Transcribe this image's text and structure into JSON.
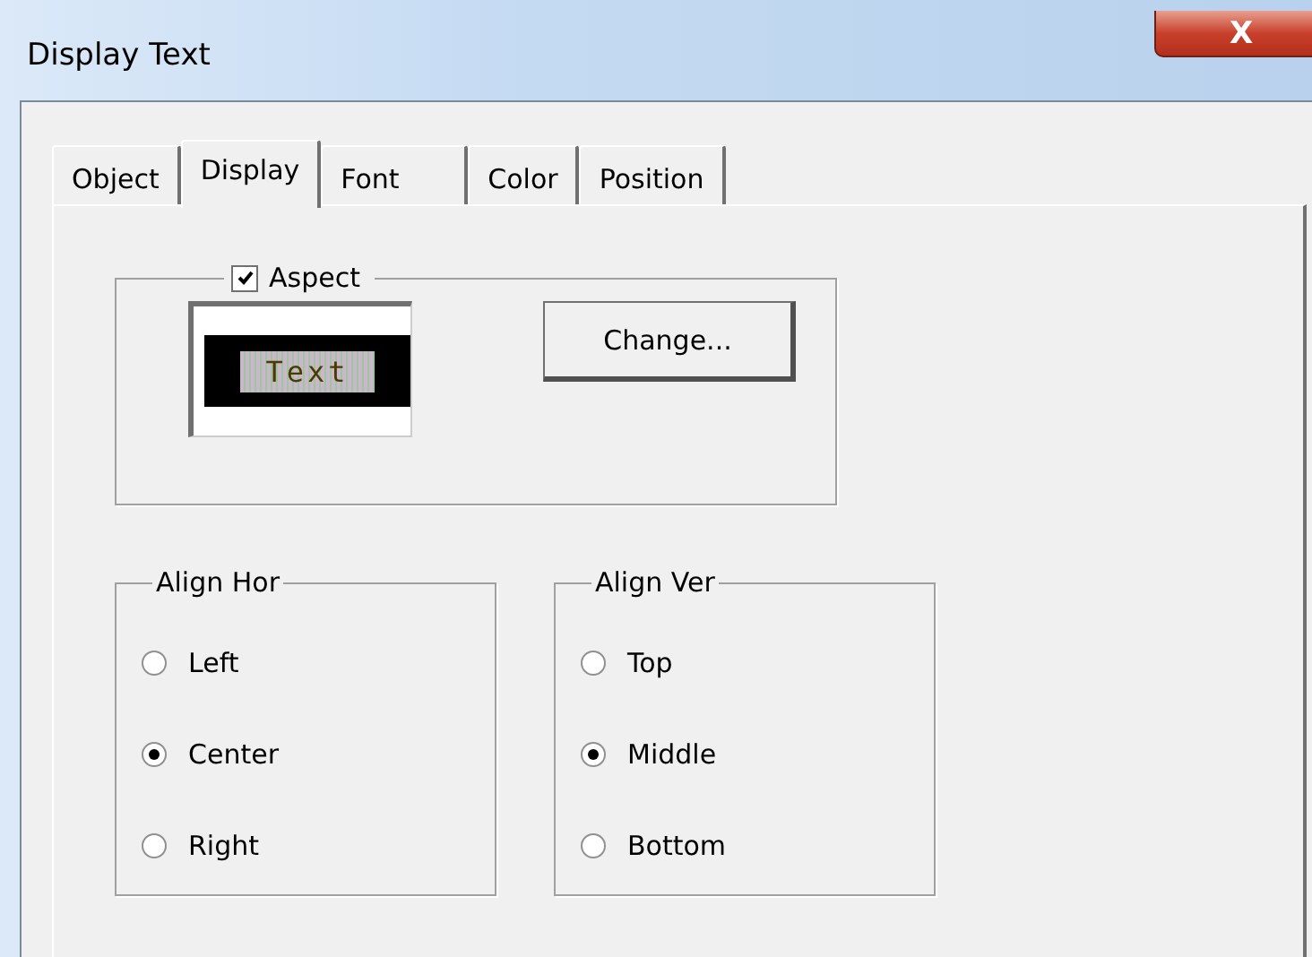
{
  "window": {
    "title": "Display Text",
    "close": "X"
  },
  "tabs": [
    {
      "label": "Object",
      "selected": false
    },
    {
      "label": "Display",
      "selected": true
    },
    {
      "label": "Font",
      "selected": false
    },
    {
      "label": "Color",
      "selected": false
    },
    {
      "label": "Position",
      "selected": false
    }
  ],
  "aspect": {
    "label": "Aspect",
    "checked": true,
    "preview_text": "Text",
    "button": "Change..."
  },
  "groups": [
    {
      "title": "Align Hor",
      "options": [
        {
          "label": "Left",
          "selected": false
        },
        {
          "label": "Center",
          "selected": true
        },
        {
          "label": "Right",
          "selected": false
        }
      ]
    },
    {
      "title": "Align Ver",
      "options": [
        {
          "label": "Top",
          "selected": false
        },
        {
          "label": "Middle",
          "selected": true
        },
        {
          "label": "Bottom",
          "selected": false
        }
      ]
    }
  ]
}
